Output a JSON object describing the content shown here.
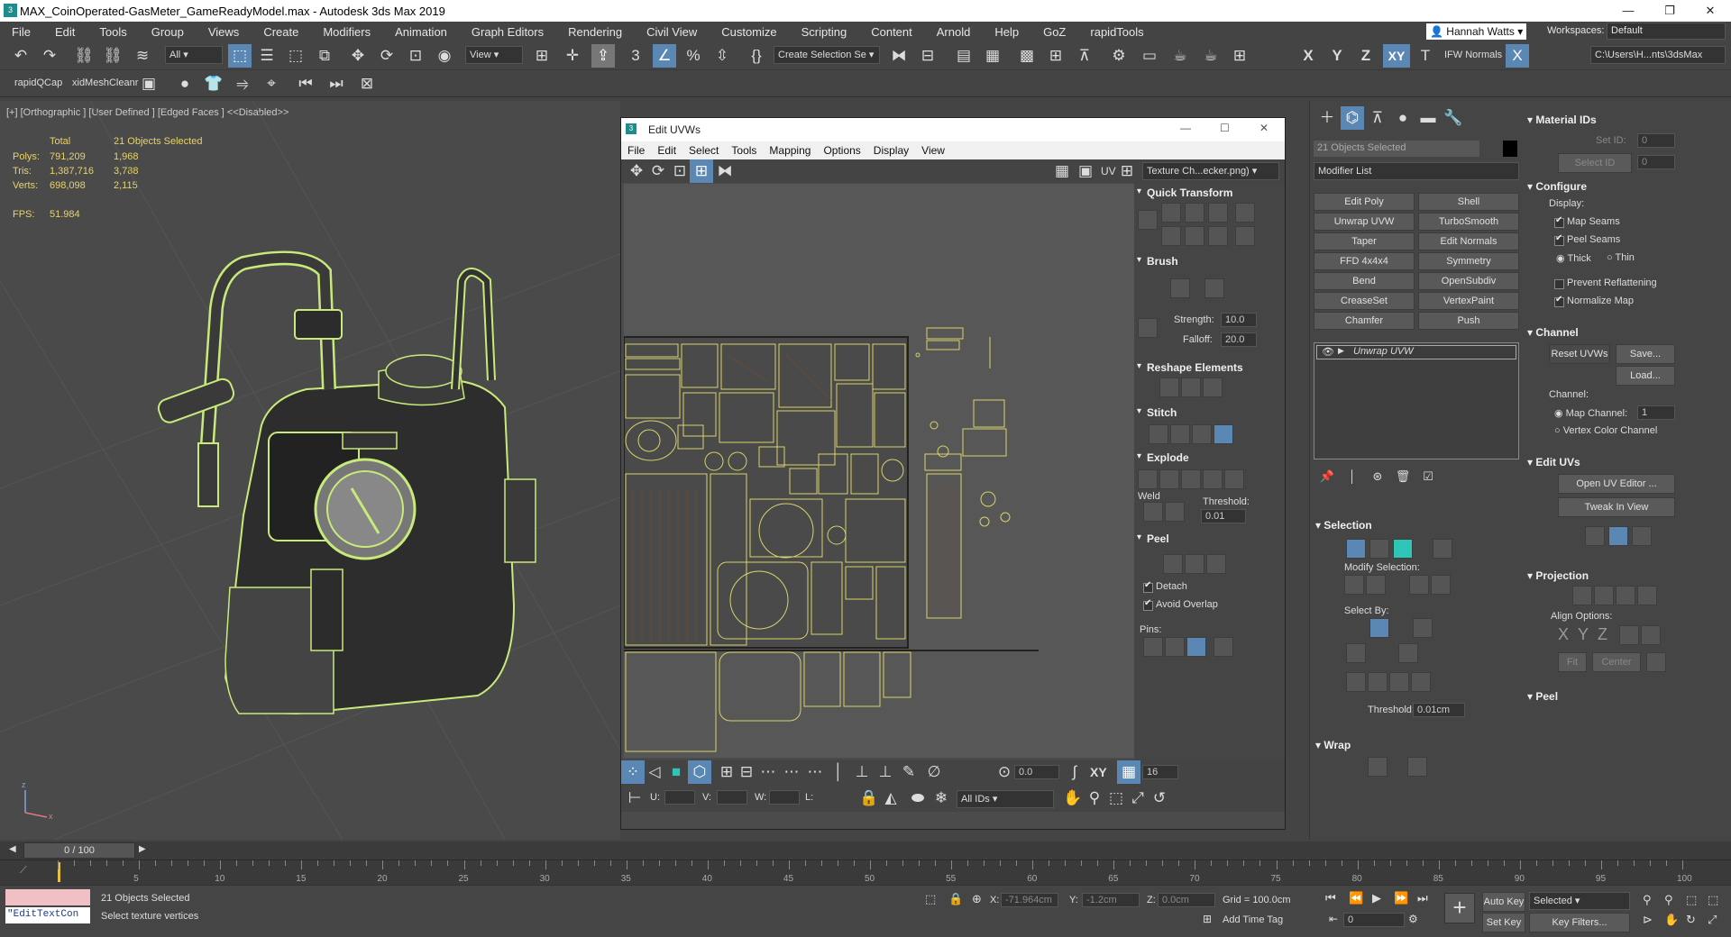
{
  "window": {
    "title": "MAX_CoinOperated-GasMeter_GameReadyModel.max - Autodesk 3ds Max 2019"
  },
  "menu": [
    "File",
    "Edit",
    "Tools",
    "Group",
    "Views",
    "Create",
    "Modifiers",
    "Animation",
    "Graph Editors",
    "Rendering",
    "Civil View",
    "Customize",
    "Scripting",
    "Content",
    "Arnold",
    "Help",
    "GoZ",
    "rapidTools"
  ],
  "user": {
    "name": "Hannah Watts",
    "workspaces_label": "Workspaces:",
    "workspace": "Default"
  },
  "toolbar": {
    "selection_filter": "All",
    "ref_coord": "View",
    "named_selection": "Create Selection Se",
    "axes": [
      "X",
      "Y",
      "Z",
      "XY"
    ],
    "ifw_normals": "IFW Normals",
    "path": "C:\\Users\\H...nts\\3dsMax",
    "rapid_qcap": "rapidQCap",
    "mesh_cleaner": "xidMeshCleanr"
  },
  "viewport": {
    "label": "[+] [Orthographic ] [User Defined ] [Edged Faces ]  <<Disabled>>",
    "stats": {
      "col_total": "Total",
      "col_selected": "21 Objects Selected",
      "polys_label": "Polys:",
      "polys_total": "791,209",
      "polys_sel": "1,968",
      "tris_label": "Tris:",
      "tris_total": "1,387,716",
      "tris_sel": "3,788",
      "verts_label": "Verts:",
      "verts_total": "698,098",
      "verts_sel": "2,115",
      "fps_label": "FPS:",
      "fps": "51.984"
    }
  },
  "uv_editor": {
    "title": "Edit UVWs",
    "menu": [
      "File",
      "Edit",
      "Select",
      "Tools",
      "Mapping",
      "Options",
      "Display",
      "View"
    ],
    "uv_label": "UV",
    "texture": "Texture Ch...ecker.png)",
    "rollouts": {
      "quick_transform": "Quick Transform",
      "brush": "Brush",
      "strength_label": "Strength:",
      "strength": "10.0",
      "falloff_label": "Falloff:",
      "falloff": "20.0",
      "reshape": "Reshape Elements",
      "stitch": "Stitch",
      "explode": "Explode",
      "weld": "Weld",
      "threshold_label": "Threshold:",
      "threshold": "0.01",
      "peel": "Peel",
      "detach": "Detach",
      "avoid_overlap": "Avoid Overlap",
      "pins": "Pins:"
    },
    "bottom": {
      "angle": "0.0",
      "xy": "XY",
      "grid_value": "16",
      "u_label": "U:",
      "v_label": "V:",
      "w_label": "W:",
      "l_label": "L:",
      "all_ids": "All IDs"
    }
  },
  "command_panel": {
    "selection_name": "21 Objects Selected",
    "modifier_list": "Modifier List",
    "modifier_buttons": [
      "Edit Poly",
      "Shell",
      "Unwrap UVW",
      "TurboSmooth",
      "Taper",
      "Edit Normals",
      "FFD 4x4x4",
      "Symmetry",
      "Bend",
      "OpenSubdiv",
      "CreaseSet",
      "VertexPaint",
      "Chamfer",
      "Push"
    ],
    "stack_item": "Unwrap UVW",
    "selection_title": "Selection",
    "modify_selection": "Modify Selection:",
    "select_by": "Select By:",
    "threshold_label": "Threshold:",
    "threshold": "0.01cm",
    "wrap_title": "Wrap"
  },
  "modifier_panel": {
    "material_ids": "Material IDs",
    "set_id": "Set ID:",
    "set_id_val": "0",
    "select_id": "Select ID",
    "select_id_val": "0",
    "configure": "Configure",
    "display": "Display:",
    "map_seams": "Map Seams",
    "peel_seams": "Peel Seams",
    "thick": "Thick",
    "thin": "Thin",
    "prevent_reflattening": "Prevent Reflattening",
    "normalize_map": "Normalize Map",
    "channel_title": "Channel",
    "reset_uvws": "Reset UVWs",
    "save": "Save...",
    "load": "Load...",
    "channel_label": "Channel:",
    "map_channel": "Map Channel:",
    "map_channel_val": "1",
    "vertex_color_channel": "Vertex Color Channel",
    "edit_uvs": "Edit UVs",
    "open_uv_editor": "Open UV Editor ...",
    "tweak_in_view": "Tweak In View",
    "projection": "Projection",
    "align_options": "Align Options:",
    "align_axes": [
      "X",
      "Y",
      "Z"
    ],
    "fit": "Fit",
    "center": "Center",
    "peel_title": "Peel"
  },
  "timeline": {
    "frame": "0 / 100",
    "ticks": [
      "5",
      "10",
      "15",
      "20",
      "25",
      "30",
      "35",
      "40",
      "45",
      "50",
      "55",
      "60",
      "65",
      "70",
      "75",
      "80",
      "85",
      "90",
      "95",
      "100"
    ]
  },
  "status": {
    "script": "\"EditTextCon",
    "selected": "21 Objects Selected",
    "prompt": "Select texture vertices",
    "x_label": "X:",
    "x_val": "-71.964cm",
    "y_label": "Y:",
    "y_val": "-1.2cm",
    "z_label": "Z:",
    "z_val": "0.0cm",
    "grid": "Grid = 100.0cm",
    "add_time_tag": "Add Time Tag",
    "auto_key": "Auto Key",
    "set_key": "Set Key",
    "key_mode": "Selected",
    "key_filters": "Key Filters...",
    "frame_val": "0"
  },
  "colors": {
    "accent": "#5b87b5",
    "wire": "#c8ea7a",
    "stats": "#e8d36a",
    "uv_lines": "#d8d36a"
  }
}
